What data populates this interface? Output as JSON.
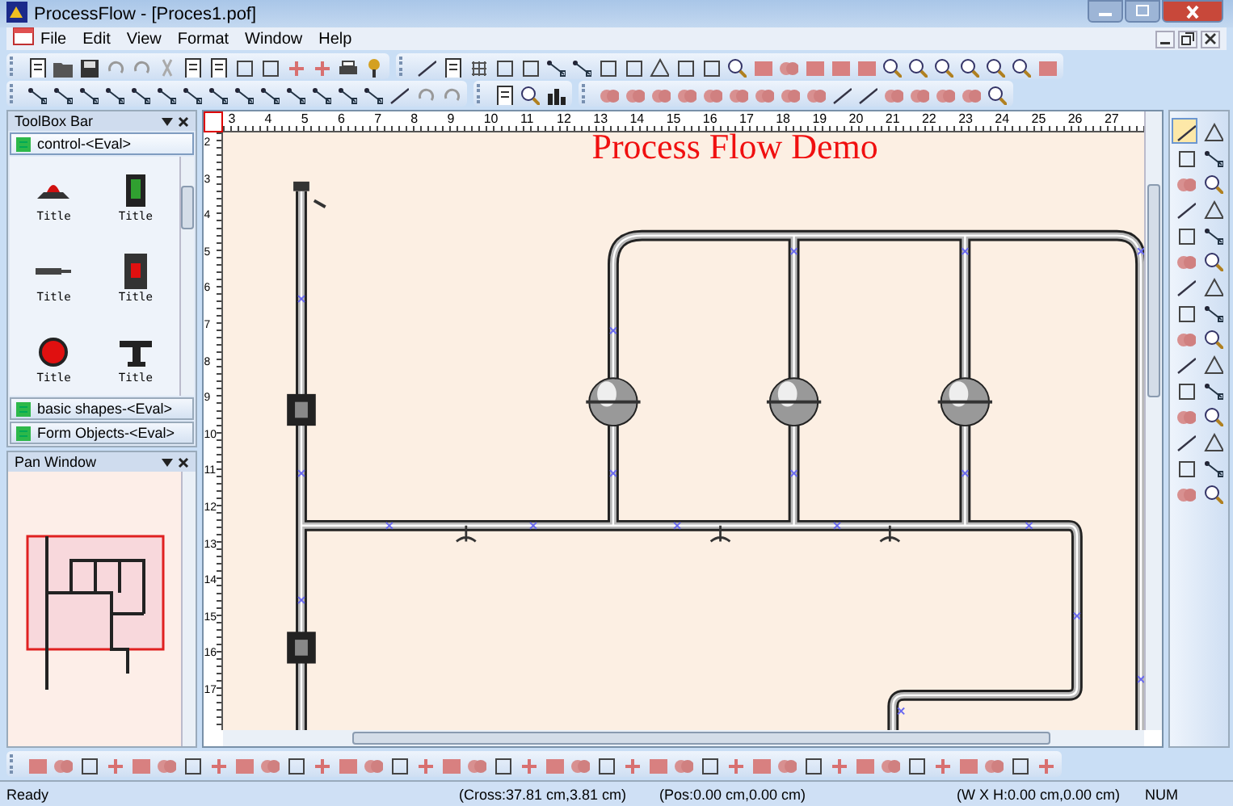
{
  "window": {
    "title": "ProcessFlow - [Proces1.pof]"
  },
  "menu": [
    {
      "label": "File"
    },
    {
      "label": "Edit"
    },
    {
      "label": "View"
    },
    {
      "label": "Format"
    },
    {
      "label": "Window"
    },
    {
      "label": "Help"
    }
  ],
  "toolbox": {
    "title": "ToolBox Bar",
    "sections": [
      {
        "label": "control-<Eval>",
        "expanded": true,
        "items": [
          {
            "label": "Title"
          },
          {
            "label": "Title"
          },
          {
            "label": "Title"
          },
          {
            "label": "Title"
          },
          {
            "label": "Title"
          },
          {
            "label": "Title"
          }
        ]
      },
      {
        "label": "basic shapes-<Eval>",
        "expanded": false
      },
      {
        "label": "Form Objects-<Eval>",
        "expanded": false
      }
    ]
  },
  "pan_window": {
    "title": "Pan Window"
  },
  "rulers": {
    "horizontal": [
      "3",
      "4",
      "5",
      "6",
      "7",
      "8",
      "9",
      "10",
      "11",
      "12",
      "13",
      "14",
      "15",
      "16",
      "17",
      "18",
      "19",
      "20",
      "21",
      "22",
      "23",
      "24",
      "25",
      "26",
      "27"
    ],
    "vertical": [
      "2",
      "3",
      "4",
      "5",
      "6",
      "7",
      "8",
      "9",
      "10",
      "11",
      "12",
      "13",
      "14",
      "15",
      "16",
      "17"
    ]
  },
  "canvas": {
    "title": "Process Flow Demo"
  },
  "status_bar": [
    "Ready",
    "(Cross:37.81 cm,3.81 cm)",
    "(Pos:0.00 cm,0.00 cm)",
    "(W X H:0.00 cm,0.00 cm)",
    "NUM"
  ]
}
